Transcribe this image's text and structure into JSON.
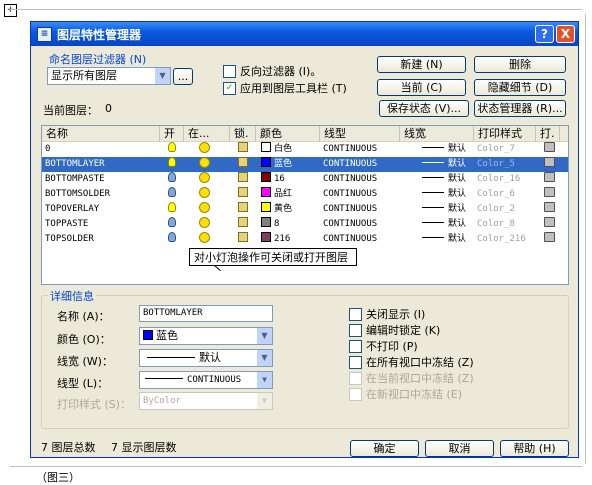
{
  "document": {
    "caption": "（图三）"
  },
  "window": {
    "title": "图层特性管理器",
    "help_label": "?",
    "close_label": "X"
  },
  "filter": {
    "group_label": "命名图层过滤器 (N)",
    "selected": "显示所有图层",
    "browse_label": "...",
    "invert_label": "反向过滤器 (I)。",
    "invert_checked": false,
    "apply_toolbar_label": "应用到图层工具栏 (T)",
    "apply_toolbar_checked": true
  },
  "buttons": {
    "new": "新建 (N)",
    "delete": "删除",
    "current": "当前 (C)",
    "hide_details": "隐藏细节 (D)",
    "save_state": "保存状态 (V)...",
    "state_manager": "状态管理器 (R)...",
    "ok": "确定",
    "cancel": "取消",
    "help": "帮助 (H)"
  },
  "current_layer": {
    "label": "当前图层：",
    "value": "0"
  },
  "columns": [
    "名称",
    "开",
    "在...",
    "锁.",
    "颜色",
    "线型",
    "线宽",
    "打印样式",
    "打."
  ],
  "layers": [
    {
      "name": "0",
      "on": true,
      "color_name": "白色",
      "color_hex": "#ffffff",
      "linetype": "CONTINUOUS",
      "lineweight": "默认",
      "plot_style": "Color_7",
      "selected": false
    },
    {
      "name": "BOTTOMLAYER",
      "on": true,
      "color_name": "蓝色",
      "color_hex": "#0000ff",
      "linetype": "CONTINUOUS",
      "lineweight": "默认",
      "plot_style": "Color_5",
      "selected": true
    },
    {
      "name": "BOTTOMPASTE",
      "on": false,
      "color_name": "16",
      "color_hex": "#7f0000",
      "linetype": "CONTINUOUS",
      "lineweight": "默认",
      "plot_style": "Color_16",
      "selected": false
    },
    {
      "name": "BOTTOMSOLDER",
      "on": false,
      "color_name": "品红",
      "color_hex": "#ff00ff",
      "linetype": "CONTINUOUS",
      "lineweight": "默认",
      "plot_style": "Color_6",
      "selected": false
    },
    {
      "name": "TOPOVERLAY",
      "on": true,
      "color_name": "黄色",
      "color_hex": "#ffff00",
      "linetype": "CONTINUOUS",
      "lineweight": "默认",
      "plot_style": "Color_2",
      "selected": false
    },
    {
      "name": "TOPPASTE",
      "on": false,
      "color_name": "8",
      "color_hex": "#808080",
      "linetype": "CONTINUOUS",
      "lineweight": "默认",
      "plot_style": "Color_8",
      "selected": false
    },
    {
      "name": "TOPSOLDER",
      "on": false,
      "color_name": "216",
      "color_hex": "#7f3f5f",
      "linetype": "CONTINUOUS",
      "lineweight": "默认",
      "plot_style": "Color_216",
      "selected": false
    }
  ],
  "tooltip": "对小灯泡操作可关闭或打开图层",
  "details": {
    "title": "详细信息",
    "name_label": "名称 (A)：",
    "name_value": "BOTTOMLAYER",
    "color_label": "颜色 (O)：",
    "color_value": "蓝色",
    "color_hex": "#0000ff",
    "lineweight_label": "线宽 (W)：",
    "lineweight_value": "默认",
    "linetype_label": "线型 (L)：",
    "linetype_value": "CONTINUOUS",
    "plotstyle_label": "打印样式 (S)：",
    "plotstyle_value": "ByColor",
    "checks": [
      {
        "label": "关闭显示 (I)",
        "checked": false,
        "disabled": false
      },
      {
        "label": "编辑时锁定 (K)",
        "checked": false,
        "disabled": false
      },
      {
        "label": "不打印 (P)",
        "checked": false,
        "disabled": false
      },
      {
        "label": "在所有视口中冻结 (Z)",
        "checked": false,
        "disabled": false
      },
      {
        "label": "在当前视口中冻结 (Z)",
        "checked": false,
        "disabled": true
      },
      {
        "label": "在新视口中冻结 (E)",
        "checked": false,
        "disabled": true
      }
    ]
  },
  "status": {
    "total": "7 图层总数",
    "shown": "7 显示图层数"
  }
}
